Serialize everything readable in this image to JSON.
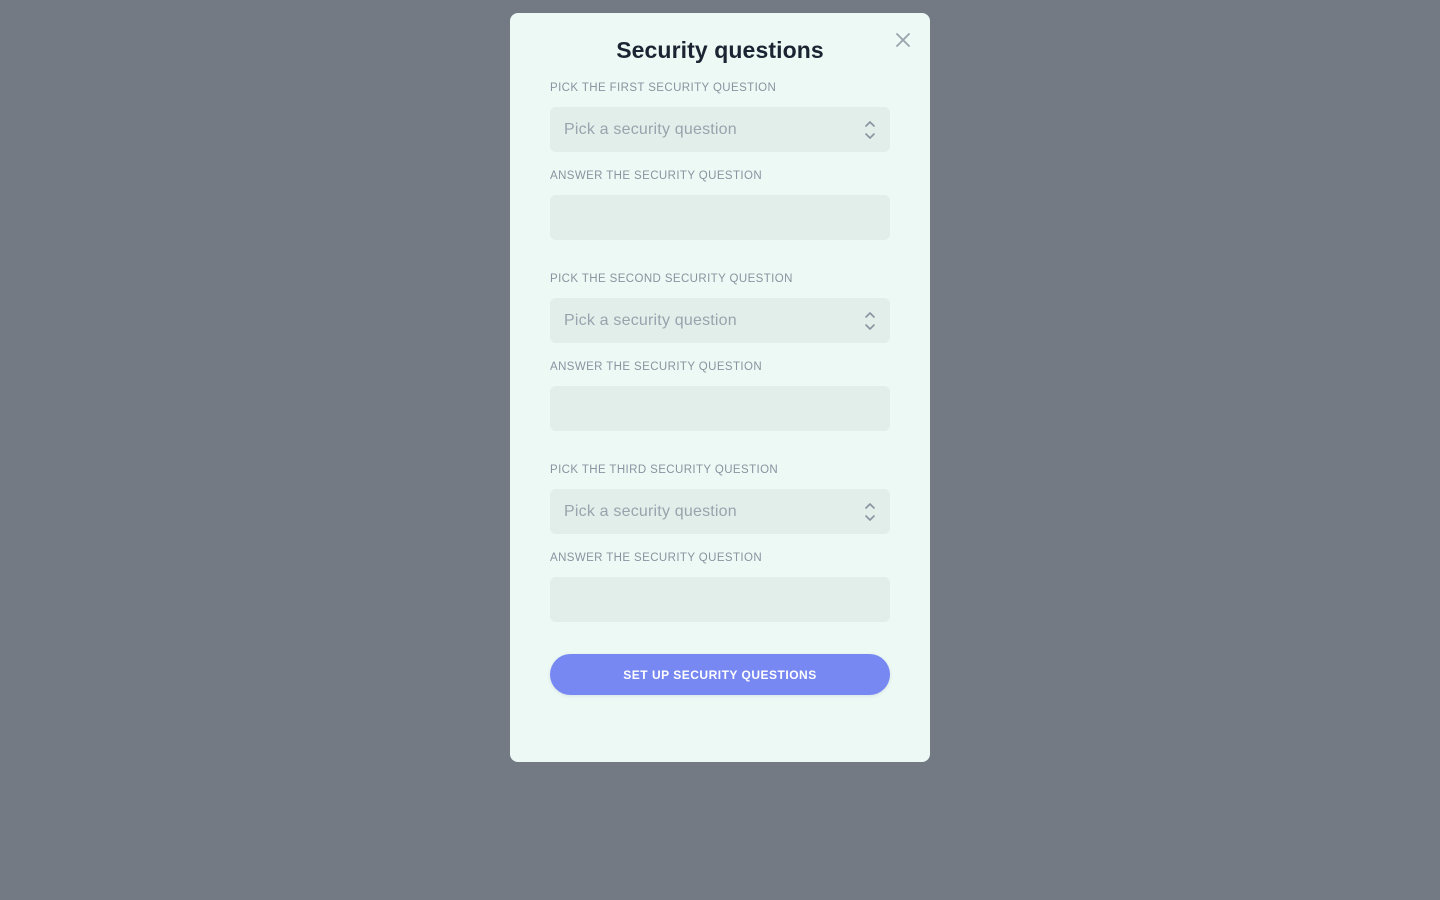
{
  "modal": {
    "title": "Security questions",
    "close_label": "Close",
    "groups": [
      {
        "question_label": "Pick the first security question",
        "select_placeholder": "Pick a security question",
        "answer_label": "Answer the security question",
        "answer_value": ""
      },
      {
        "question_label": "Pick the second security question",
        "select_placeholder": "Pick a security question",
        "answer_label": "Answer the security question",
        "answer_value": ""
      },
      {
        "question_label": "Pick the third security question",
        "select_placeholder": "Pick a security question",
        "answer_label": "Answer the security question",
        "answer_value": ""
      }
    ],
    "submit_label": "Set up security questions"
  },
  "icons": {
    "close": "close-icon",
    "select_chevron": "chevron-up-down-icon"
  },
  "colors": {
    "backdrop": "#747a84",
    "modal_bg": "#edf9f4",
    "field_bg": "#e2eeea",
    "label_text": "#8a93a0",
    "title_text": "#1c2433",
    "primary_button": "#7788f2"
  }
}
